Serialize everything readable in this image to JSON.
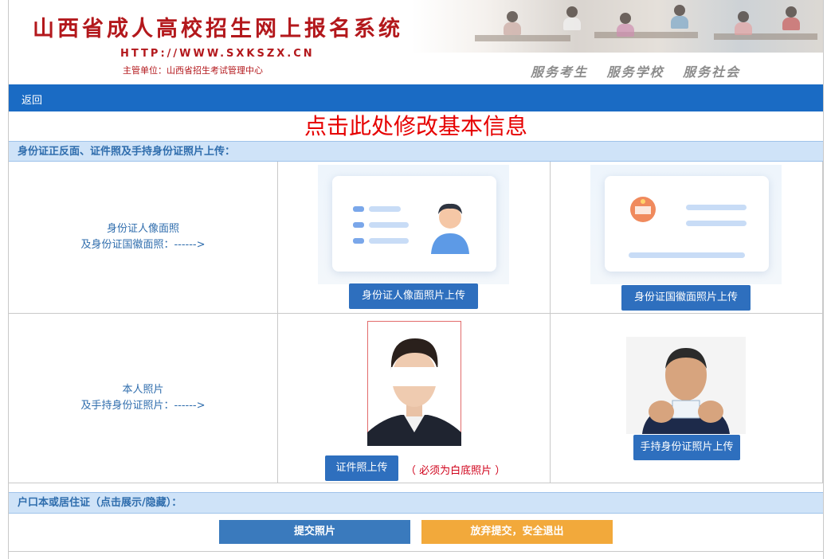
{
  "banner": {
    "title": "山西省成人高校招生网上报名系统",
    "url": "HTTP://WWW.SXKSZX.CN",
    "subtitle": "主管单位：山西省招生考试管理中心",
    "slogan": "服务考生 服务学校 服务社会"
  },
  "nav": {
    "back_label": "返回"
  },
  "edit_link": "点击此处修改基本信息",
  "section_id": {
    "header": "身份证正反面、证件照及手持身份证照片上传：",
    "row1_label_line1": "身份证人像面照",
    "row1_label_line2": "及身份证国徽面照：------>",
    "front_button": "身份证人像面照片上传",
    "back_button": "身份证国徽面照片上传",
    "row2_label_line1": "本人照片",
    "row2_label_line2": "及手持身份证照片：------>",
    "photo_button": "证件照上传",
    "photo_note": "（ 必须为白底照片 ）",
    "handheld_button": "手持身份证照片上传"
  },
  "section_household": {
    "header": "户口本或居住证（点击展示/隐藏）："
  },
  "actions": {
    "submit": "提交照片",
    "abandon": "放弃提交，安全退出"
  },
  "colors": {
    "nav": "#1a6bc4",
    "button": "#2e6fbe",
    "submit": "#3a7abd",
    "abandon": "#f2a93b",
    "alert": "#e60000"
  }
}
